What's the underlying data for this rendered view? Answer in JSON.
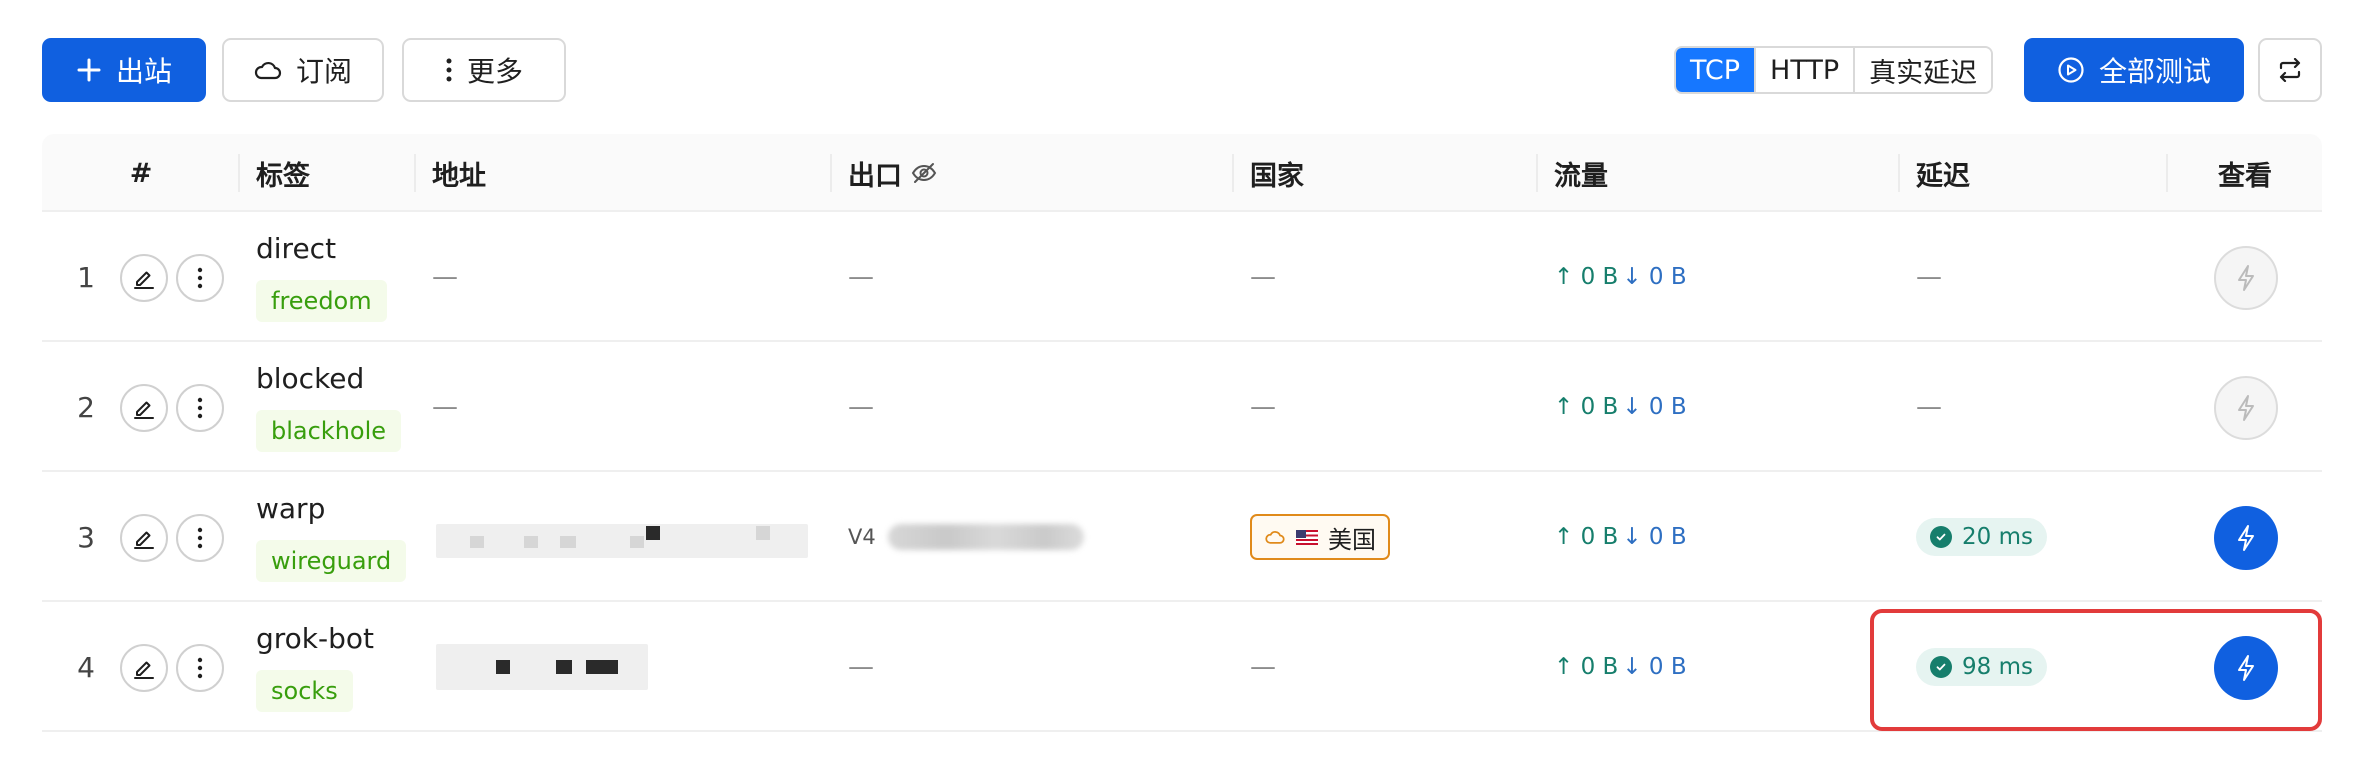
{
  "toolbar": {
    "add_outbound": "出站",
    "subscribe": "订阅",
    "more": "更多",
    "test_modes": [
      "TCP",
      "HTTP",
      "真实延迟"
    ],
    "active_mode": "TCP",
    "test_all": "全部测试"
  },
  "table": {
    "columns": [
      "#",
      "标签",
      "地址",
      "出口",
      "国家",
      "流量",
      "延迟",
      "查看"
    ],
    "rows": [
      {
        "index": "1",
        "tag": "direct",
        "type": "freedom",
        "address": "—",
        "exit": "—",
        "country": "—",
        "up": "↑ 0 B",
        "down": "↓ 0 B",
        "latency": "—"
      },
      {
        "index": "2",
        "tag": "blocked",
        "type": "blackhole",
        "address": "—",
        "exit": "—",
        "country": "—",
        "up": "↑ 0 B",
        "down": "↓ 0 B",
        "latency": "—"
      },
      {
        "index": "3",
        "tag": "warp",
        "type": "wireguard",
        "address": "",
        "exit_prefix": "V4",
        "country": "美国",
        "up": "↑ 0 B",
        "down": "↓ 0 B",
        "latency": "20 ms"
      },
      {
        "index": "4",
        "tag": "grok-bot",
        "type": "socks",
        "address": "",
        "exit": "—",
        "country": "—",
        "up": "↑ 0 B",
        "down": "↓ 0 B",
        "latency": "98 ms"
      }
    ]
  },
  "colors": {
    "primary": "#1060e0",
    "tag_green": "#389e0d",
    "latency_green": "#167e6c",
    "country_border": "#e08a1a",
    "highlight": "#e23b3b"
  }
}
